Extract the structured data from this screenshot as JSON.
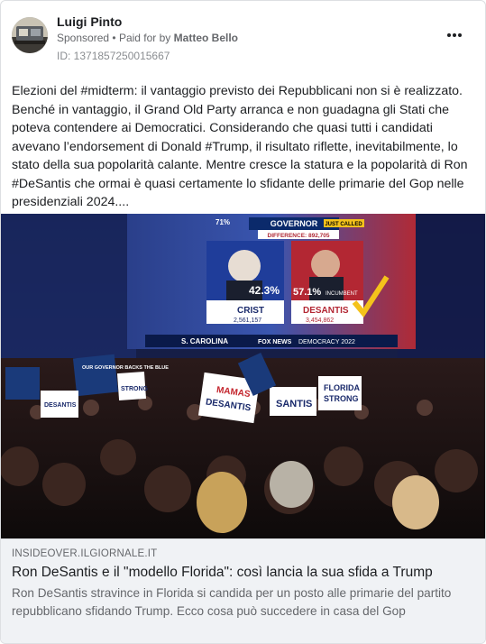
{
  "post": {
    "page_name": "Luigi Pinto",
    "sponsored_label": "Sponsored",
    "separator": "•",
    "paid_for_prefix": "Paid for by",
    "payer": "Matteo Bello",
    "ad_id": "ID: 1371857250015667",
    "more_icon": "more-horizontal-icon",
    "text": "Elezioni del #midterm: il vantaggio previsto dei Repubblicani non si è realizzato. Benché in vantaggio, il Grand Old Party arranca e non guadagna gli Stati che poteva contendere ai Democratici. Considerando che quasi tutti i candidati avevano l’endorsement di Donald #Trump, il risultato riflette, inevitabilmente, lo stato della sua popolarità calante. Mentre cresce la statura e la popolarità di Ron #DeSantis che ormai è quasi certamente lo sfidante delle primarie del Gop nelle presidenziali 2024...."
  },
  "image": {
    "screen_header": "GOVERNOR",
    "percent_top": "71%",
    "tag_just_called": "JUST CALLED",
    "difference": "DIFFERENCE: 892,705",
    "candidate1_pct": "42.3%",
    "candidate1_name": "CRIST",
    "candidate1_votes": "2,561,157",
    "candidate2_pct": "57.1%",
    "candidate2_tag": "INCUMBENT",
    "candidate2_name": "DESANTIS",
    "candidate2_votes": "3,454,862",
    "ticker_left": "S. CAROLINA",
    "ticker_network": "FOX NEWS",
    "ticker_right": "DEMOCRACY 2022",
    "sign_gov_backs": "OUR GOVERNOR BACKS THE BLUE",
    "sign_mamas_1": "MAMAS",
    "sign_mamas_2": "DESANTIS",
    "sign_florida_1": "FLORIDA",
    "sign_florida_2": "STRONG",
    "sign_santis": "SANTIS",
    "sign_strong": "STRONG",
    "sign_desantis_small": "DESANTIS"
  },
  "link": {
    "domain": "INSIDEOVER.ILGIORNALE.IT",
    "title": "Ron DeSantis e il \"modello Florida\": così lancia la sua sfida a Trump",
    "description": "Ron DeSantis stravince in Florida si candida per un posto alle primarie del partito repubblicano sfidando Trump. Ecco cosa può succedere in casa del Gop"
  }
}
